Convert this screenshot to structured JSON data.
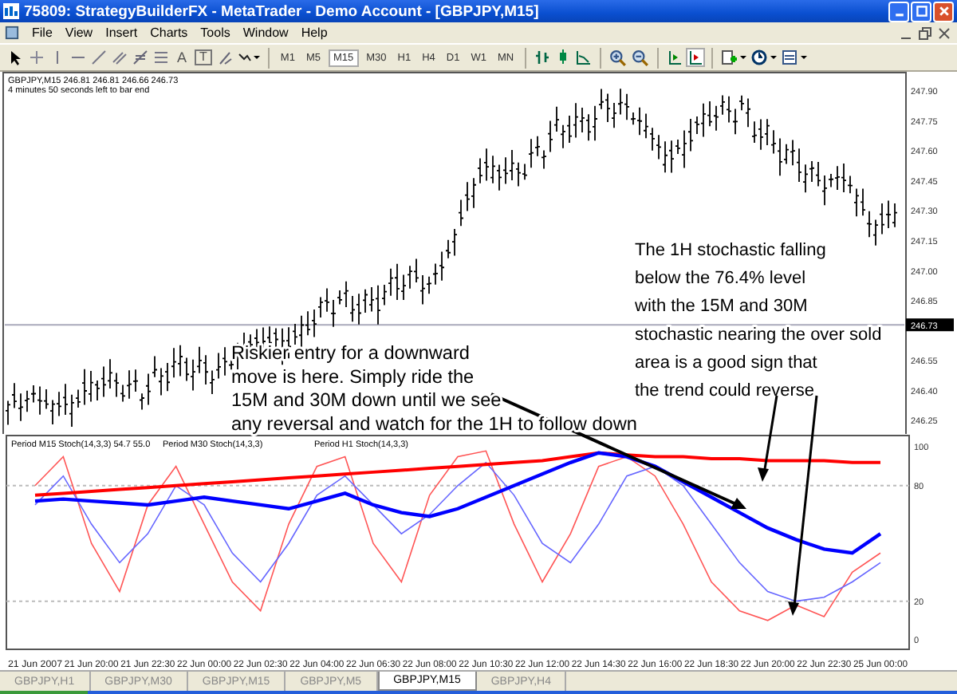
{
  "window": {
    "title": "75809: StrategyBuilderFX - MetaTrader - Demo Account - [GBPJPY,M15]"
  },
  "menu": [
    "File",
    "View",
    "Insert",
    "Charts",
    "Tools",
    "Window",
    "Help"
  ],
  "toolbar": {
    "text_tools": [
      "A",
      "T"
    ],
    "timeframes": [
      {
        "label": "M1",
        "selected": false
      },
      {
        "label": "M5",
        "selected": false
      },
      {
        "label": "M15",
        "selected": true
      },
      {
        "label": "M30",
        "selected": false
      },
      {
        "label": "H1",
        "selected": false
      },
      {
        "label": "H4",
        "selected": false
      },
      {
        "label": "D1",
        "selected": false
      },
      {
        "label": "W1",
        "selected": false
      },
      {
        "label": "MN",
        "selected": false
      }
    ]
  },
  "chart": {
    "info": "GBPJPY,M15  246.81 246.81 246.66 246.73",
    "timer": "4 minutes 50 seconds left to bar end",
    "price_ticks": [
      "247.90",
      "247.75",
      "247.60",
      "247.45",
      "247.30",
      "247.15",
      "247.00",
      "246.85",
      "246.55",
      "246.40",
      "246.25"
    ],
    "current_price": "246.73",
    "indicator_labels": [
      "Period M15 Stoch(14,3,3) 54.7 55.0",
      "Period M30 Stoch(14,3,3)",
      "Period H1 Stoch(14,3,3)"
    ],
    "chart_data": {
      "type": "line",
      "ylim": [
        -5,
        106
      ],
      "yticks": [
        0,
        20,
        80,
        100
      ],
      "categories": [
        "21 Jun 2007",
        null,
        "21 Jun 20:00",
        null,
        "21 Jun 22:30",
        null,
        "22 Jun 00:00",
        null,
        "22 Jun 02:30",
        null,
        "22 Jun 04:00",
        null,
        "22 Jun 06:30",
        null,
        "22 Jun 08:00",
        null,
        "22 Jun 10:30",
        null,
        "22 Jun 12:00",
        null,
        "22 Jun 14:30",
        null,
        "22 Jun 16:00",
        null,
        "22 Jun 18:30",
        null,
        "22 Jun 20:00",
        null,
        "22 Jun 22:30",
        null,
        "25 Jun 00:00"
      ],
      "series": [
        {
          "color": "#ff5555",
          "values": [
            80,
            95,
            50,
            25,
            70,
            90,
            60,
            30,
            15,
            60,
            90,
            95,
            50,
            30,
            75,
            95,
            98,
            60,
            30,
            55,
            90,
            95,
            85,
            60,
            30,
            15,
            10,
            18,
            12,
            35,
            45
          ]
        },
        {
          "color": "#6666ff",
          "values": [
            70,
            85,
            60,
            40,
            55,
            80,
            70,
            45,
            30,
            50,
            75,
            85,
            70,
            55,
            65,
            80,
            92,
            75,
            50,
            40,
            60,
            85,
            90,
            80,
            60,
            40,
            25,
            20,
            22,
            30,
            40
          ]
        },
        {
          "color": "#ff0000",
          "values": [
            75,
            76,
            77,
            78,
            79,
            80,
            81,
            82,
            83,
            84,
            85,
            86,
            87,
            88,
            89,
            90,
            91,
            92,
            93,
            95,
            97,
            96,
            95,
            95,
            94,
            94,
            93,
            93,
            93,
            92,
            92
          ]
        },
        {
          "color": "#0000ff",
          "values": [
            72,
            73,
            72,
            71,
            70,
            72,
            74,
            72,
            70,
            68,
            72,
            76,
            70,
            66,
            64,
            68,
            74,
            80,
            86,
            92,
            97,
            95,
            90,
            82,
            74,
            66,
            58,
            52,
            47,
            45,
            55
          ]
        }
      ]
    },
    "annotations": [
      {
        "lines": [
          "Riskier entry for a downward",
          "move is here.  Simply ride the",
          "15M and 30M down until we see",
          "any reversal and watch for the 1H to follow down"
        ]
      },
      {
        "lines": [
          "The 1H stochastic falling",
          "below the 76.4% level",
          "with the 15M and 30M",
          "stochastic nearing the over sold",
          "area is a good sign that",
          "the trend could reverse"
        ]
      }
    ]
  },
  "tabs": [
    {
      "label": "GBPJPY,H1",
      "selected": false
    },
    {
      "label": "GBPJPY,M30",
      "selected": false
    },
    {
      "label": "GBPJPY,M15",
      "selected": false
    },
    {
      "label": "GBPJPY,M5",
      "selected": false
    },
    {
      "label": "GBPJPY,M15",
      "selected": true
    },
    {
      "label": "GBPJPY,H4",
      "selected": false
    }
  ]
}
